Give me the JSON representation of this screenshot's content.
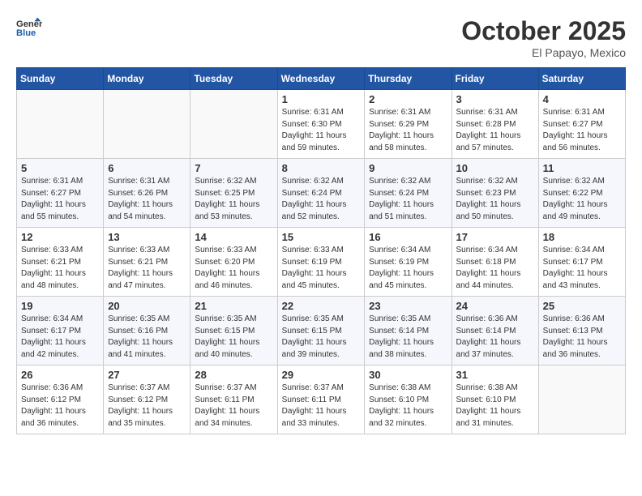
{
  "header": {
    "logo_line1": "General",
    "logo_line2": "Blue",
    "month": "October 2025",
    "location": "El Papayo, Mexico"
  },
  "days_of_week": [
    "Sunday",
    "Monday",
    "Tuesday",
    "Wednesday",
    "Thursday",
    "Friday",
    "Saturday"
  ],
  "weeks": [
    [
      {
        "day": "",
        "sunrise": "",
        "sunset": "",
        "daylight": ""
      },
      {
        "day": "",
        "sunrise": "",
        "sunset": "",
        "daylight": ""
      },
      {
        "day": "",
        "sunrise": "",
        "sunset": "",
        "daylight": ""
      },
      {
        "day": "1",
        "sunrise": "Sunrise: 6:31 AM",
        "sunset": "Sunset: 6:30 PM",
        "daylight": "Daylight: 11 hours and 59 minutes."
      },
      {
        "day": "2",
        "sunrise": "Sunrise: 6:31 AM",
        "sunset": "Sunset: 6:29 PM",
        "daylight": "Daylight: 11 hours and 58 minutes."
      },
      {
        "day": "3",
        "sunrise": "Sunrise: 6:31 AM",
        "sunset": "Sunset: 6:28 PM",
        "daylight": "Daylight: 11 hours and 57 minutes."
      },
      {
        "day": "4",
        "sunrise": "Sunrise: 6:31 AM",
        "sunset": "Sunset: 6:27 PM",
        "daylight": "Daylight: 11 hours and 56 minutes."
      }
    ],
    [
      {
        "day": "5",
        "sunrise": "Sunrise: 6:31 AM",
        "sunset": "Sunset: 6:27 PM",
        "daylight": "Daylight: 11 hours and 55 minutes."
      },
      {
        "day": "6",
        "sunrise": "Sunrise: 6:31 AM",
        "sunset": "Sunset: 6:26 PM",
        "daylight": "Daylight: 11 hours and 54 minutes."
      },
      {
        "day": "7",
        "sunrise": "Sunrise: 6:32 AM",
        "sunset": "Sunset: 6:25 PM",
        "daylight": "Daylight: 11 hours and 53 minutes."
      },
      {
        "day": "8",
        "sunrise": "Sunrise: 6:32 AM",
        "sunset": "Sunset: 6:24 PM",
        "daylight": "Daylight: 11 hours and 52 minutes."
      },
      {
        "day": "9",
        "sunrise": "Sunrise: 6:32 AM",
        "sunset": "Sunset: 6:24 PM",
        "daylight": "Daylight: 11 hours and 51 minutes."
      },
      {
        "day": "10",
        "sunrise": "Sunrise: 6:32 AM",
        "sunset": "Sunset: 6:23 PM",
        "daylight": "Daylight: 11 hours and 50 minutes."
      },
      {
        "day": "11",
        "sunrise": "Sunrise: 6:32 AM",
        "sunset": "Sunset: 6:22 PM",
        "daylight": "Daylight: 11 hours and 49 minutes."
      }
    ],
    [
      {
        "day": "12",
        "sunrise": "Sunrise: 6:33 AM",
        "sunset": "Sunset: 6:21 PM",
        "daylight": "Daylight: 11 hours and 48 minutes."
      },
      {
        "day": "13",
        "sunrise": "Sunrise: 6:33 AM",
        "sunset": "Sunset: 6:21 PM",
        "daylight": "Daylight: 11 hours and 47 minutes."
      },
      {
        "day": "14",
        "sunrise": "Sunrise: 6:33 AM",
        "sunset": "Sunset: 6:20 PM",
        "daylight": "Daylight: 11 hours and 46 minutes."
      },
      {
        "day": "15",
        "sunrise": "Sunrise: 6:33 AM",
        "sunset": "Sunset: 6:19 PM",
        "daylight": "Daylight: 11 hours and 45 minutes."
      },
      {
        "day": "16",
        "sunrise": "Sunrise: 6:34 AM",
        "sunset": "Sunset: 6:19 PM",
        "daylight": "Daylight: 11 hours and 45 minutes."
      },
      {
        "day": "17",
        "sunrise": "Sunrise: 6:34 AM",
        "sunset": "Sunset: 6:18 PM",
        "daylight": "Daylight: 11 hours and 44 minutes."
      },
      {
        "day": "18",
        "sunrise": "Sunrise: 6:34 AM",
        "sunset": "Sunset: 6:17 PM",
        "daylight": "Daylight: 11 hours and 43 minutes."
      }
    ],
    [
      {
        "day": "19",
        "sunrise": "Sunrise: 6:34 AM",
        "sunset": "Sunset: 6:17 PM",
        "daylight": "Daylight: 11 hours and 42 minutes."
      },
      {
        "day": "20",
        "sunrise": "Sunrise: 6:35 AM",
        "sunset": "Sunset: 6:16 PM",
        "daylight": "Daylight: 11 hours and 41 minutes."
      },
      {
        "day": "21",
        "sunrise": "Sunrise: 6:35 AM",
        "sunset": "Sunset: 6:15 PM",
        "daylight": "Daylight: 11 hours and 40 minutes."
      },
      {
        "day": "22",
        "sunrise": "Sunrise: 6:35 AM",
        "sunset": "Sunset: 6:15 PM",
        "daylight": "Daylight: 11 hours and 39 minutes."
      },
      {
        "day": "23",
        "sunrise": "Sunrise: 6:35 AM",
        "sunset": "Sunset: 6:14 PM",
        "daylight": "Daylight: 11 hours and 38 minutes."
      },
      {
        "day": "24",
        "sunrise": "Sunrise: 6:36 AM",
        "sunset": "Sunset: 6:14 PM",
        "daylight": "Daylight: 11 hours and 37 minutes."
      },
      {
        "day": "25",
        "sunrise": "Sunrise: 6:36 AM",
        "sunset": "Sunset: 6:13 PM",
        "daylight": "Daylight: 11 hours and 36 minutes."
      }
    ],
    [
      {
        "day": "26",
        "sunrise": "Sunrise: 6:36 AM",
        "sunset": "Sunset: 6:12 PM",
        "daylight": "Daylight: 11 hours and 36 minutes."
      },
      {
        "day": "27",
        "sunrise": "Sunrise: 6:37 AM",
        "sunset": "Sunset: 6:12 PM",
        "daylight": "Daylight: 11 hours and 35 minutes."
      },
      {
        "day": "28",
        "sunrise": "Sunrise: 6:37 AM",
        "sunset": "Sunset: 6:11 PM",
        "daylight": "Daylight: 11 hours and 34 minutes."
      },
      {
        "day": "29",
        "sunrise": "Sunrise: 6:37 AM",
        "sunset": "Sunset: 6:11 PM",
        "daylight": "Daylight: 11 hours and 33 minutes."
      },
      {
        "day": "30",
        "sunrise": "Sunrise: 6:38 AM",
        "sunset": "Sunset: 6:10 PM",
        "daylight": "Daylight: 11 hours and 32 minutes."
      },
      {
        "day": "31",
        "sunrise": "Sunrise: 6:38 AM",
        "sunset": "Sunset: 6:10 PM",
        "daylight": "Daylight: 11 hours and 31 minutes."
      },
      {
        "day": "",
        "sunrise": "",
        "sunset": "",
        "daylight": ""
      }
    ]
  ]
}
